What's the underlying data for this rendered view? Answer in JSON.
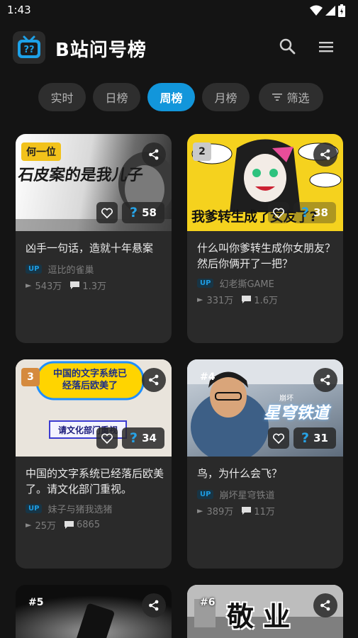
{
  "status_bar": {
    "time": "1:43"
  },
  "app": {
    "title": "B站问号榜"
  },
  "tabs": [
    {
      "label": "实时",
      "active": false
    },
    {
      "label": "日榜",
      "active": false
    },
    {
      "label": "周榜",
      "active": true
    },
    {
      "label": "月榜",
      "active": false
    },
    {
      "label": "筛选",
      "active": false
    }
  ],
  "colors": {
    "accent": "#1296db",
    "badge_gold": "#f2c21b",
    "badge_silver": "#c9c9c9",
    "badge_bronze": "#d58a3e"
  },
  "cards": [
    {
      "rank": "何一位",
      "thumb_text": "石皮案的是我儿子",
      "question_count": "58",
      "title": "凶手一句话，造就十年悬案",
      "up_tag": "UP",
      "up_name": "逗比的雀巢",
      "views": "543万",
      "comments": "1.3万"
    },
    {
      "rank": "2",
      "thumb_text": "我爹转生成了女友了?",
      "question_count": "38",
      "title": "什么叫你爹转生成你女朋友？然后你俩开了一把？",
      "up_tag": "UP",
      "up_name": "幻老撕GAME",
      "views": "331万",
      "comments": "1.6万"
    },
    {
      "rank": "3",
      "thumb_text": "中国的文字系统已经落后欧美了",
      "thumb_text2": "请文化部门重视",
      "question_count": "34",
      "title": "中国的文字系统已经落后欧美了。请文化部门重视。",
      "up_tag": "UP",
      "up_name": "妹子与猪我选猪",
      "views": "25万",
      "comments": "6865"
    },
    {
      "rank": "#4",
      "thumb_text": "星穹铁道",
      "thumb_text_small": "崩坏",
      "question_count": "31",
      "title": "鸟，为什么会飞？",
      "up_tag": "UP",
      "up_name": "崩坏星穹铁道",
      "views": "389万",
      "comments": "11万"
    },
    {
      "rank": "#5"
    },
    {
      "rank": "#6",
      "thumb_text": "敬 业"
    }
  ]
}
